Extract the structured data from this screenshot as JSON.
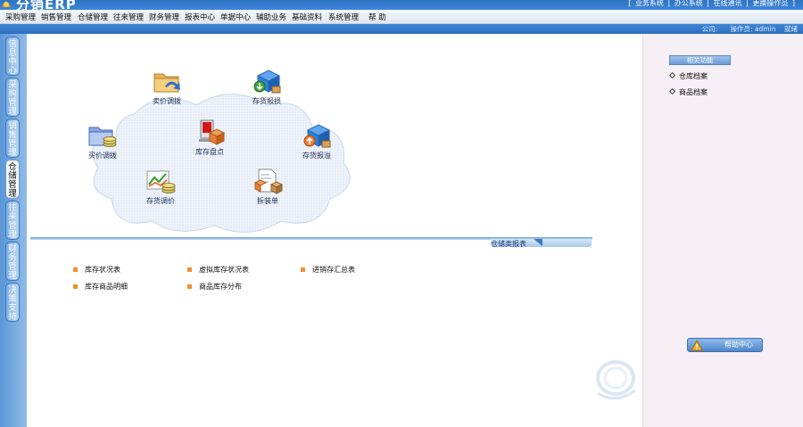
{
  "header": {
    "logo_text": "分销ERP",
    "top_links": [
      "[",
      "业务系统",
      "|",
      "办公系统",
      "|",
      "在线通讯",
      "|",
      "更换操作员",
      "]"
    ]
  },
  "menu": {
    "items": [
      "采购管理",
      "销售管理",
      "仓储管理",
      "往来管理",
      "财务管理",
      "报表中心",
      "单据中心",
      "辅助业务",
      "基础资料",
      "系统管理",
      "帮 助"
    ]
  },
  "infobar": {
    "company_label": "公司:",
    "operator_label": "操作员:",
    "operator_value": "admin",
    "status_label": "就绪"
  },
  "left_tabs": [
    {
      "label": "信息中心",
      "active": false
    },
    {
      "label": "采购管理",
      "active": false
    },
    {
      "label": "销售管理",
      "active": false
    },
    {
      "label": "仓储管理",
      "active": true
    },
    {
      "label": "往来管理",
      "active": false
    },
    {
      "label": "财务管理",
      "active": false
    },
    {
      "label": "决策支持",
      "active": false
    }
  ],
  "workflow": {
    "nodes": [
      {
        "id": "sell-price-adjust",
        "label": "卖价调拨",
        "icon": "folder-arrow-icon"
      },
      {
        "id": "stock-loss",
        "label": "存货报损",
        "icon": "box-down-icon"
      },
      {
        "id": "buy-price-adjust",
        "label": "买价调拨",
        "icon": "folder-coins-icon"
      },
      {
        "id": "inventory-count",
        "label": "库存盘点",
        "icon": "monitor-box-icon"
      },
      {
        "id": "stock-overflow",
        "label": "存货报溢",
        "icon": "box-up-icon"
      },
      {
        "id": "stock-price-adjust",
        "label": "存货调价",
        "icon": "chart-coins-icon"
      },
      {
        "id": "disassemble-bill",
        "label": "拆装单",
        "icon": "document-box-icon"
      }
    ]
  },
  "reports": {
    "title": "仓储类报表",
    "links": [
      "库存状况表",
      "虚拟库存状况表",
      "进销存汇总表",
      "库存商品明细",
      "商品库存分布"
    ]
  },
  "related": {
    "title": "相关功能",
    "items": [
      "仓库档案",
      "商品档案"
    ]
  },
  "help": {
    "label": "帮助中心"
  },
  "colors": {
    "header_blue": "#2e73c4",
    "bullet_orange": "#f09030",
    "right_panel_bg": "#f6eff5"
  }
}
